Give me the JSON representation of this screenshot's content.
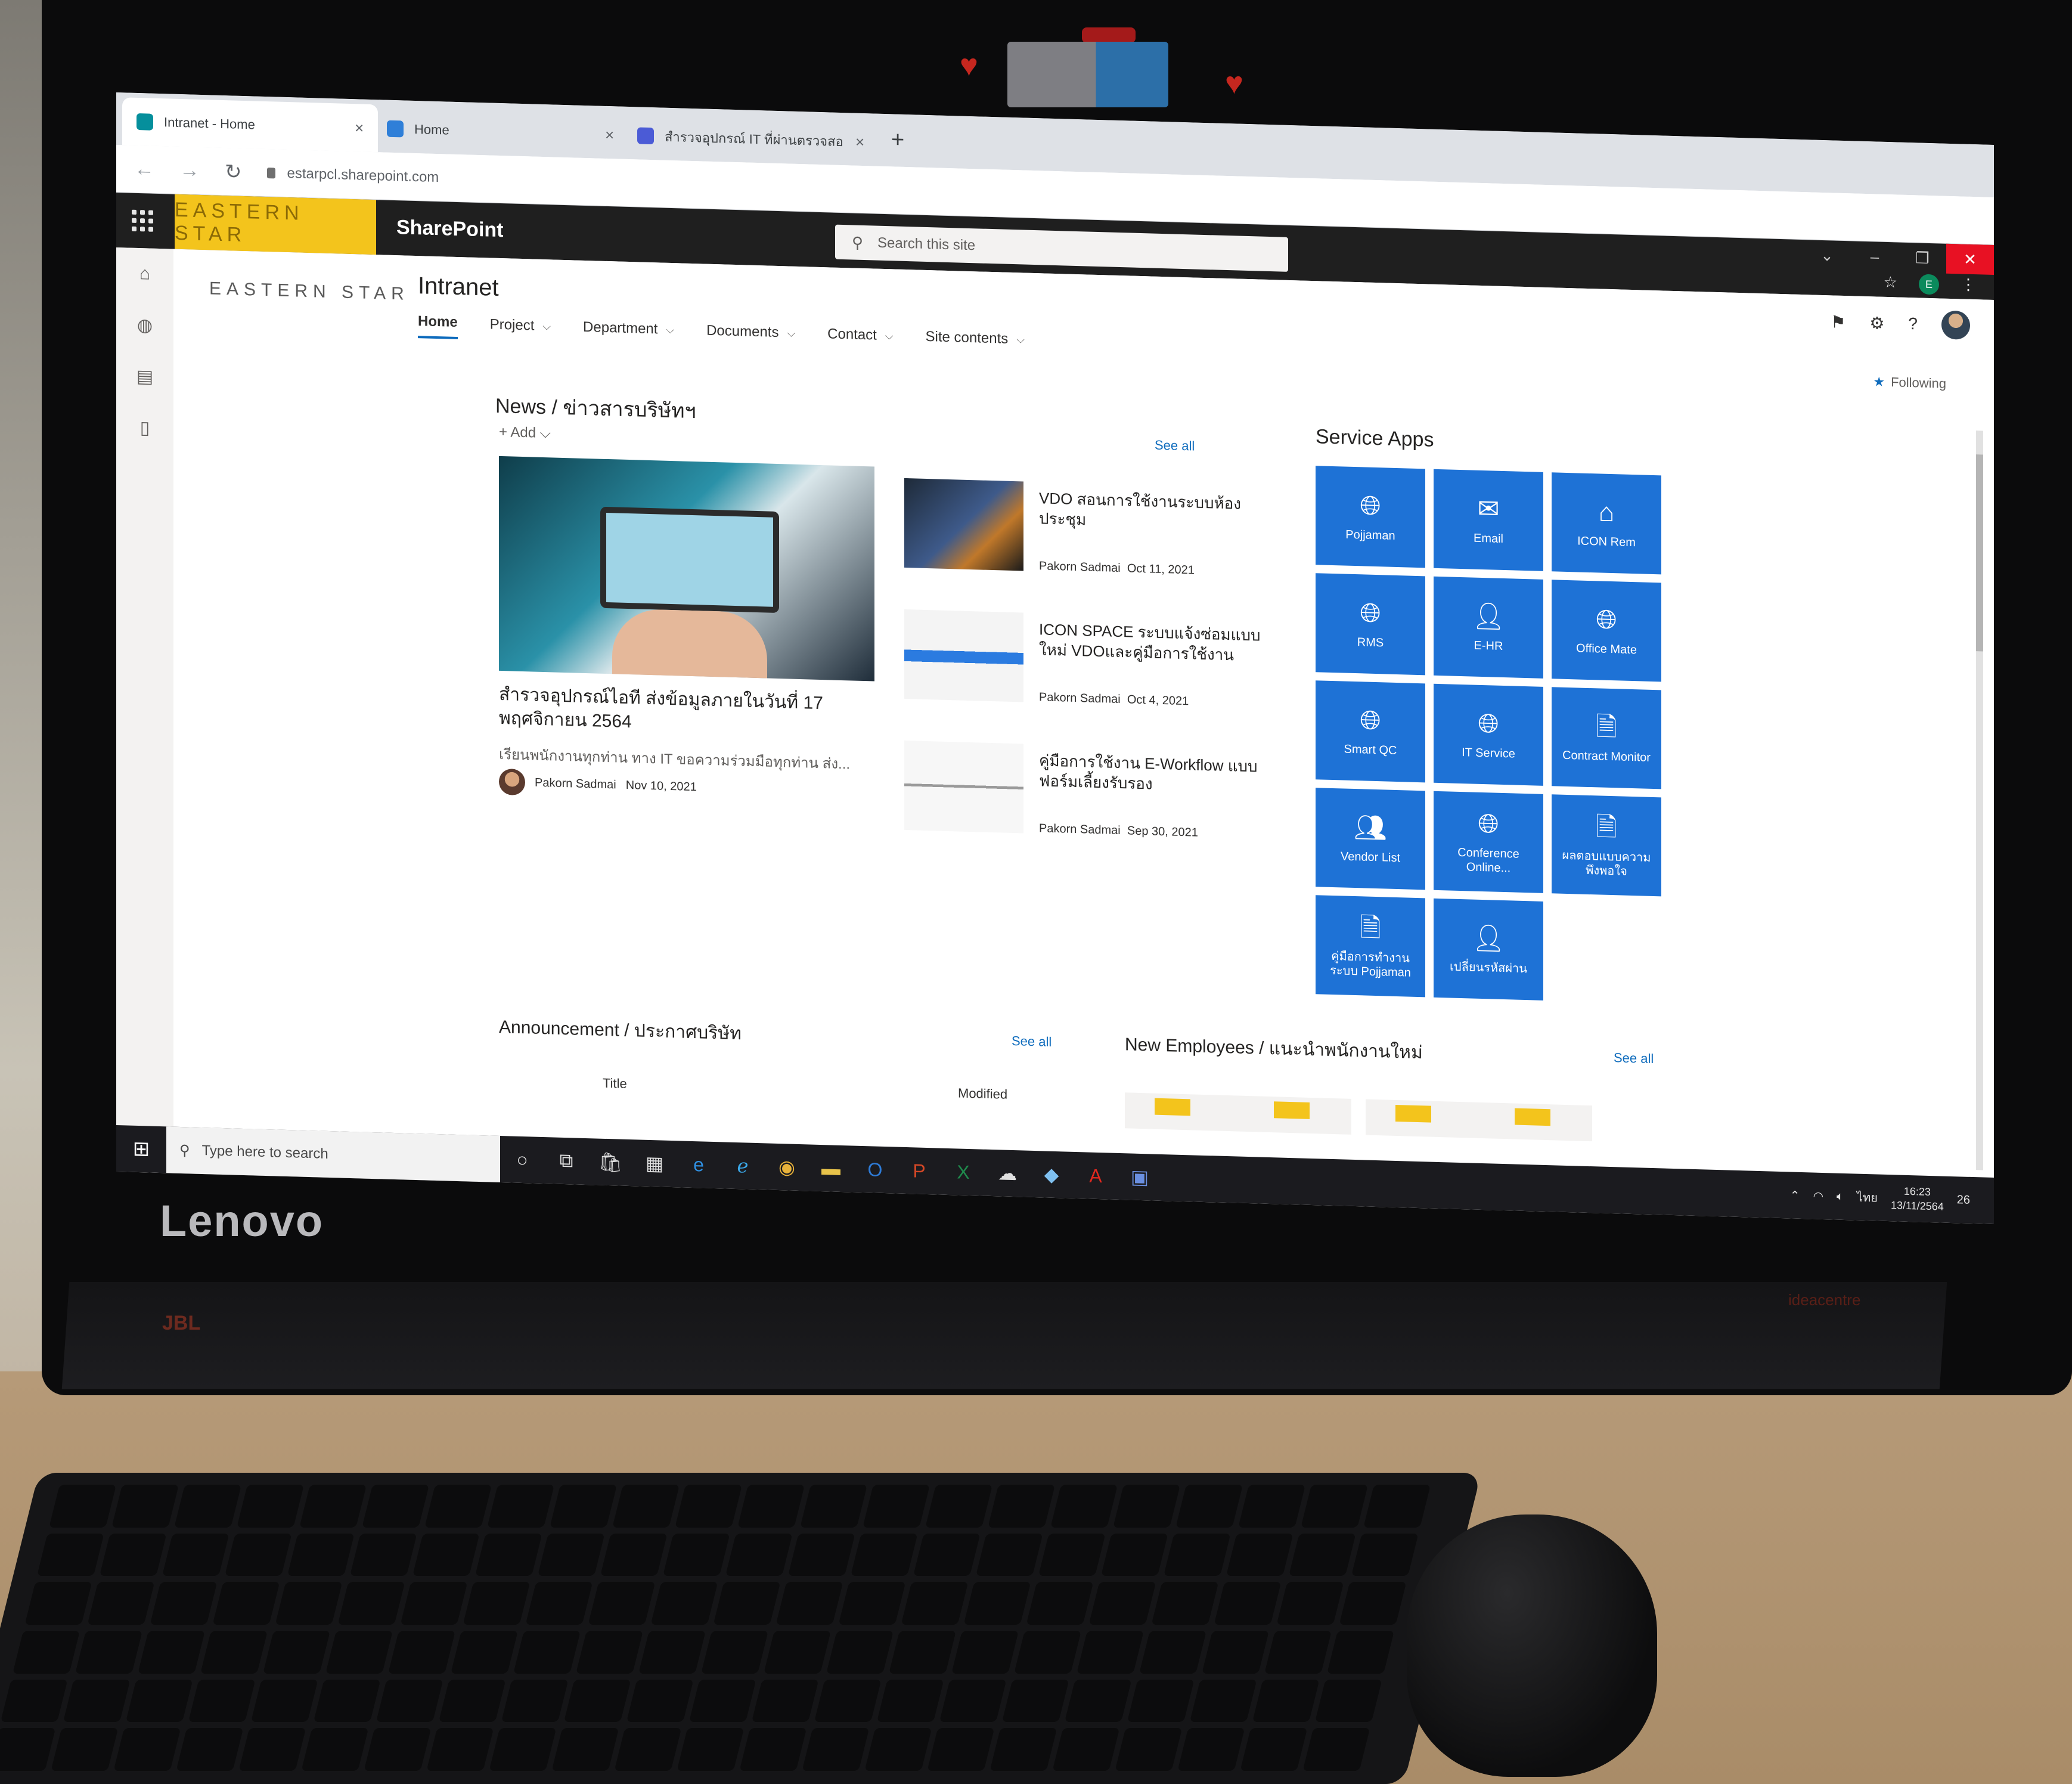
{
  "browser": {
    "tabs": [
      {
        "title": "Intranet - Home",
        "active": true
      },
      {
        "title": "Home",
        "active": false
      },
      {
        "title": "สำรวจอุปกรณ์ IT ที่ผ่านตรวจสอบของ (ป",
        "active": false
      }
    ],
    "url": "estarpcl.sharepoint.com"
  },
  "suitebar": {
    "brand": "EASTERN STAR",
    "app_name": "SharePoint",
    "search_placeholder": "Search this site",
    "profile_initial": "E"
  },
  "site": {
    "logo_text": "EASTERN STAR",
    "title": "Intranet",
    "nav": [
      "Home",
      "Project",
      "Department",
      "Documents",
      "Contact",
      "Site contents"
    ],
    "following_label": "Following"
  },
  "news": {
    "heading": "News / ข่าวสารบริษัทฯ",
    "add_label": "Add",
    "see_all": "See all",
    "hero": {
      "title": "สำรวจอุปกรณ์ไอที ส่งข้อมูลภายในวันที่ 17 พฤศจิกายน 2564",
      "description": "เรียนพนักงานทุกท่าน ทาง IT ขอความร่วมมือทุกท่าน ส่ง...",
      "author": "Pakorn Sadmai",
      "date": "Nov 10, 2021"
    },
    "items": [
      {
        "title": "VDO สอนการใช้งานระบบห้องประชุม",
        "author": "Pakorn Sadmai",
        "date": "Oct 11, 2021"
      },
      {
        "title": "ICON SPACE ระบบแจ้งซ่อมแบบใหม่ VDOและคู่มือการใช้งาน",
        "author": "Pakorn Sadmai",
        "date": "Oct 4, 2021"
      },
      {
        "title": "คู่มือการใช้งาน E-Workflow แบบฟอร์มเลี้ยงรับรอง",
        "author": "Pakorn Sadmai",
        "date": "Sep 30, 2021"
      }
    ]
  },
  "service_apps": {
    "heading": "Service Apps",
    "tiles": [
      {
        "label": "Pojjaman",
        "icon": "globe-icon"
      },
      {
        "label": "Email",
        "icon": "mail-icon"
      },
      {
        "label": "ICON Rem",
        "icon": "home-icon"
      },
      {
        "label": "RMS",
        "icon": "globe-icon"
      },
      {
        "label": "E-HR",
        "icon": "add-person-icon"
      },
      {
        "label": "Office Mate",
        "icon": "globe-icon"
      },
      {
        "label": "Smart QC",
        "icon": "globe-icon"
      },
      {
        "label": "IT Service",
        "icon": "globe-icon"
      },
      {
        "label": "Contract Monitor",
        "icon": "document-lock-icon"
      },
      {
        "label": "Vendor List",
        "icon": "people-icon"
      },
      {
        "label": "Conference Online...",
        "icon": "globe-icon"
      },
      {
        "label": "ผลตอบแบบความพึงพอใจ",
        "icon": "document-person-icon"
      },
      {
        "label": "คู่มือการทำงานระบบ Pojjaman",
        "icon": "document-icon"
      },
      {
        "label": "เปลี่ยนรหัสผ่าน",
        "icon": "person-lock-icon"
      }
    ]
  },
  "announcement": {
    "heading": "Announcement / ประกาศบริษัท",
    "see_all": "See all",
    "columns": [
      "Title",
      "Modified"
    ]
  },
  "new_employees": {
    "heading": "New Employees / แนะนำพนักงานใหม่",
    "see_all": "See all"
  },
  "taskbar": {
    "search_placeholder": "Type here to search",
    "time": "16:23",
    "date": "13/11/2564",
    "lang": "ไทย",
    "notif_count": "26"
  },
  "hardware": {
    "monitor_brand": "Lenovo",
    "speaker_brand": "JBL",
    "model": "ideacentre"
  },
  "colors": {
    "tile_blue": "#1e72d6",
    "brand_yellow": "#f3c41c",
    "suitebar": "#1f1f1f"
  }
}
